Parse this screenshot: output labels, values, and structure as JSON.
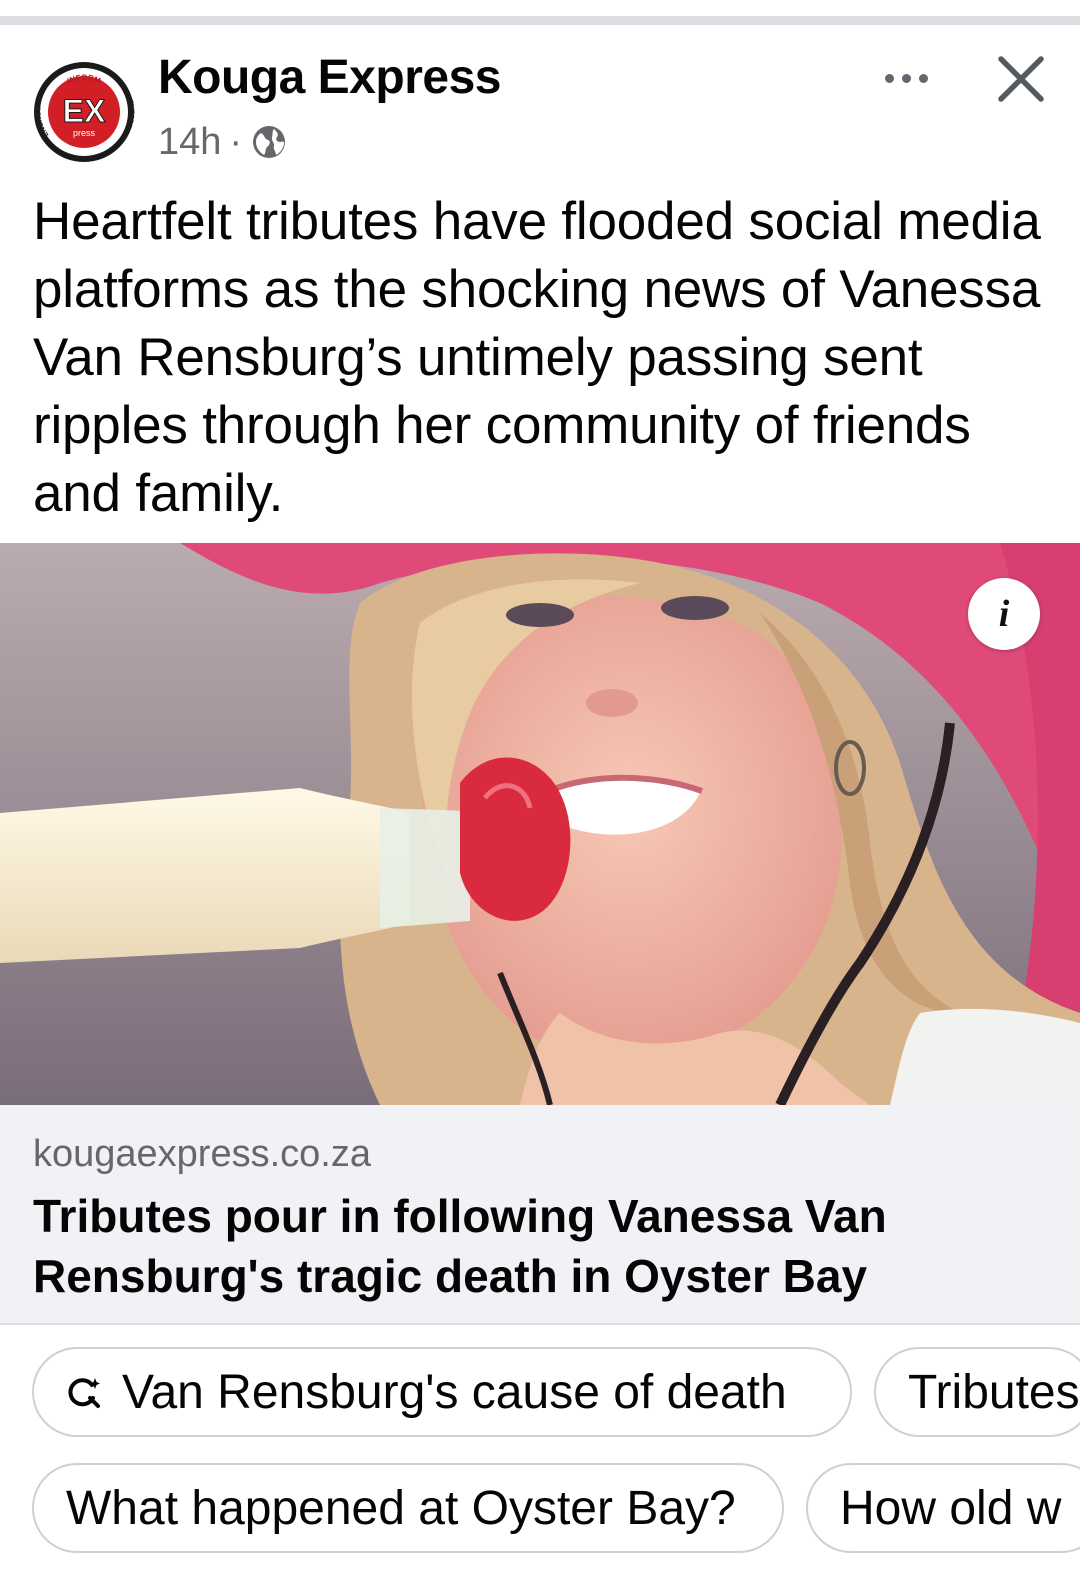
{
  "post": {
    "page_name": "Kouga Express",
    "time": "14h",
    "separator": "·",
    "text": "Heartfelt tributes have flooded social media platforms as the shocking news of Vanessa Van Rensburg’s untimely passing sent ripples through her community of friends and family.",
    "logo_text": {
      "top": "INFORM",
      "center": "EX",
      "sub": "press",
      "left": "ENGAGE",
      "right": "ENTERTAIN"
    }
  },
  "link": {
    "domain": "kougaexpress.co.za",
    "title": "Tributes pour in following Vanessa Van Rensburg's tragic death in Oyster Bay"
  },
  "info_label": "i",
  "suggestions": [
    {
      "label": "Van Rensburg's cause of death",
      "icon": "search-sparkle-icon"
    },
    {
      "label": "Tributes",
      "icon": ""
    },
    {
      "label": "What happened at Oyster Bay?",
      "icon": ""
    },
    {
      "label": "How old w",
      "icon": ""
    }
  ],
  "colors": {
    "secondary_text": "#65676b",
    "link_bg": "#f0f2f5",
    "logo_red": "#d21f26",
    "hat_pink": "#e04a78"
  }
}
